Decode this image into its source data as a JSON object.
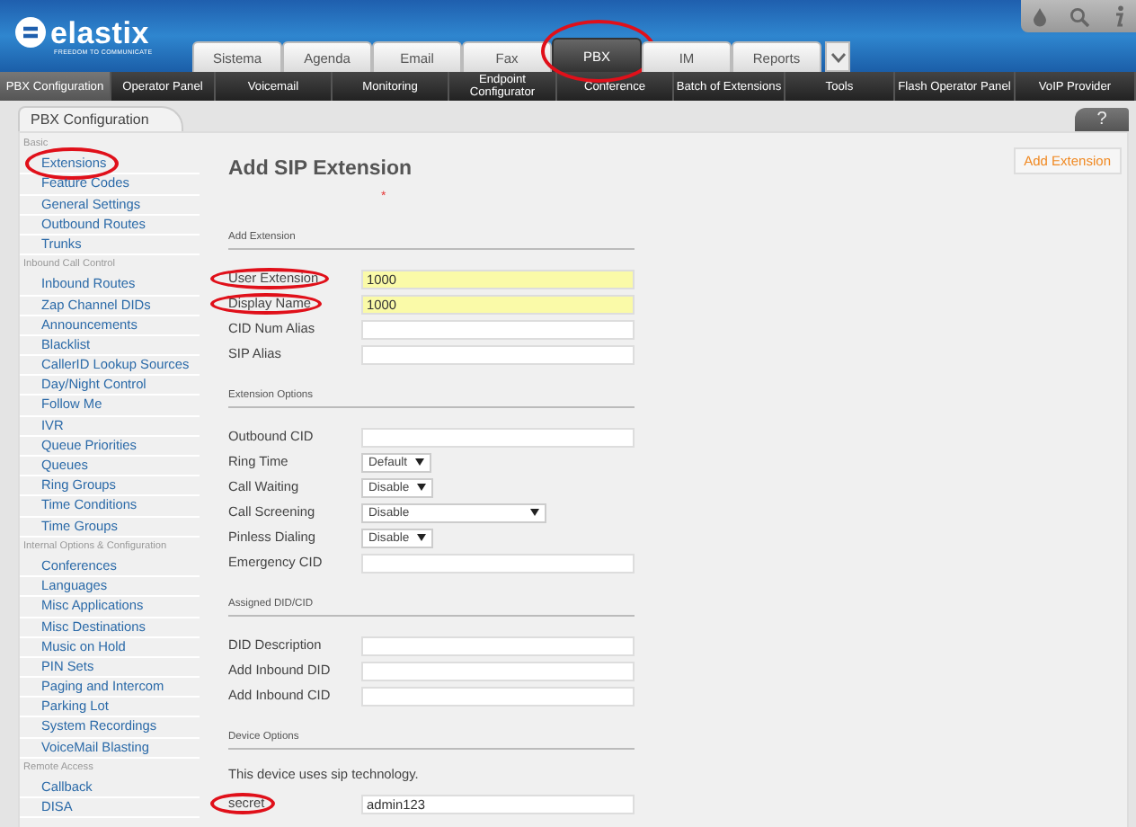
{
  "logo": {
    "name": "elastix",
    "tagline": "FREEDOM TO COMMUNICATE"
  },
  "top_tabs": [
    {
      "label": "Sistema",
      "selected": false,
      "circled": false
    },
    {
      "label": "Agenda",
      "selected": false,
      "circled": false
    },
    {
      "label": "Email",
      "selected": false,
      "circled": false
    },
    {
      "label": "Fax",
      "selected": false,
      "circled": false
    },
    {
      "label": "PBX",
      "selected": true,
      "circled": true
    },
    {
      "label": "IM",
      "selected": false,
      "circled": false
    },
    {
      "label": "Reports",
      "selected": false,
      "circled": false
    }
  ],
  "menu": [
    {
      "label": "PBX Configuration",
      "selected": true
    },
    {
      "label": "Operator Panel",
      "selected": false
    },
    {
      "label": "Voicemail",
      "selected": false
    },
    {
      "label": "Monitoring",
      "selected": false
    },
    {
      "label": "Endpoint Configurator",
      "selected": false
    },
    {
      "label": "Conference",
      "selected": false
    },
    {
      "label": "Batch of Extensions",
      "selected": false
    },
    {
      "label": "Tools",
      "selected": false
    },
    {
      "label": "Flash Operator Panel",
      "selected": false
    },
    {
      "label": "VoIP Provider",
      "selected": false
    }
  ],
  "panel_tab": "PBX Configuration",
  "help": "?",
  "sidebar": [
    {
      "heading": "Basic",
      "items": [
        {
          "label": "Extensions",
          "circled": true
        },
        {
          "label": "Feature Codes",
          "circled": false
        },
        {
          "label": "General Settings",
          "circled": false
        },
        {
          "label": "Outbound Routes",
          "circled": false
        },
        {
          "label": "Trunks",
          "circled": false
        }
      ]
    },
    {
      "heading": "Inbound Call Control",
      "items": [
        {
          "label": "Inbound Routes",
          "circled": false
        },
        {
          "label": "Zap Channel DIDs",
          "circled": false
        },
        {
          "label": "Announcements",
          "circled": false
        },
        {
          "label": "Blacklist",
          "circled": false
        },
        {
          "label": "CallerID Lookup Sources",
          "circled": false
        },
        {
          "label": "Day/Night Control",
          "circled": false
        },
        {
          "label": "Follow Me",
          "circled": false
        },
        {
          "label": "IVR",
          "circled": false
        },
        {
          "label": "Queue Priorities",
          "circled": false
        },
        {
          "label": "Queues",
          "circled": false
        },
        {
          "label": "Ring Groups",
          "circled": false
        },
        {
          "label": "Time Conditions",
          "circled": false
        },
        {
          "label": "Time Groups",
          "circled": false
        }
      ]
    },
    {
      "heading": "Internal Options & Configuration",
      "items": [
        {
          "label": "Conferences",
          "circled": false
        },
        {
          "label": "Languages",
          "circled": false
        },
        {
          "label": "Misc Applications",
          "circled": false
        },
        {
          "label": "Misc Destinations",
          "circled": false
        },
        {
          "label": "Music on Hold",
          "circled": false
        },
        {
          "label": "PIN Sets",
          "circled": false
        },
        {
          "label": "Paging and Intercom",
          "circled": false
        },
        {
          "label": "Parking Lot",
          "circled": false
        },
        {
          "label": "System Recordings",
          "circled": false
        },
        {
          "label": "VoiceMail Blasting",
          "circled": false
        }
      ]
    },
    {
      "heading": "Remote Access",
      "items": [
        {
          "label": "Callback",
          "circled": false
        },
        {
          "label": "DISA",
          "circled": false
        }
      ]
    }
  ],
  "page_title": "Add SIP Extension",
  "required_mark": "*",
  "add_button": "Add Extension",
  "sections": [
    {
      "title": "Add Extension",
      "rows": [
        {
          "kind": "text",
          "label": "User Extension",
          "value": "1000",
          "highlighted": true,
          "circled": true
        },
        {
          "kind": "text",
          "label": "Display Name",
          "value": "1000",
          "highlighted": true,
          "circled": true
        },
        {
          "kind": "text",
          "label": "CID Num Alias",
          "value": "",
          "highlighted": false,
          "circled": false
        },
        {
          "kind": "text",
          "label": "SIP Alias",
          "value": "",
          "highlighted": false,
          "circled": false
        }
      ]
    },
    {
      "title": "Extension Options",
      "rows": [
        {
          "kind": "text",
          "label": "Outbound CID",
          "value": "",
          "highlighted": false,
          "circled": false
        },
        {
          "kind": "select",
          "label": "Ring Time",
          "value": "Default",
          "circled": false
        },
        {
          "kind": "select",
          "label": "Call Waiting",
          "value": "Disable",
          "circled": false
        },
        {
          "kind": "select",
          "label": "Call Screening",
          "value": "Disable",
          "circled": false
        },
        {
          "kind": "select",
          "label": "Pinless Dialing",
          "value": "Disable",
          "circled": false
        },
        {
          "kind": "text",
          "label": "Emergency CID",
          "value": "",
          "highlighted": false,
          "circled": false
        }
      ]
    },
    {
      "title": "Assigned DID/CID",
      "rows": [
        {
          "kind": "text",
          "label": "DID Description",
          "value": "",
          "highlighted": false,
          "circled": false
        },
        {
          "kind": "text",
          "label": "Add Inbound DID",
          "value": "",
          "highlighted": false,
          "circled": false
        },
        {
          "kind": "text",
          "label": "Add Inbound CID",
          "value": "",
          "highlighted": false,
          "circled": false
        }
      ]
    },
    {
      "title": "Device Options",
      "rows": [
        {
          "kind": "note",
          "label": "This device uses sip technology."
        },
        {
          "kind": "text",
          "label": "secret",
          "value": "admin123",
          "highlighted": false,
          "circled": true
        }
      ]
    }
  ]
}
